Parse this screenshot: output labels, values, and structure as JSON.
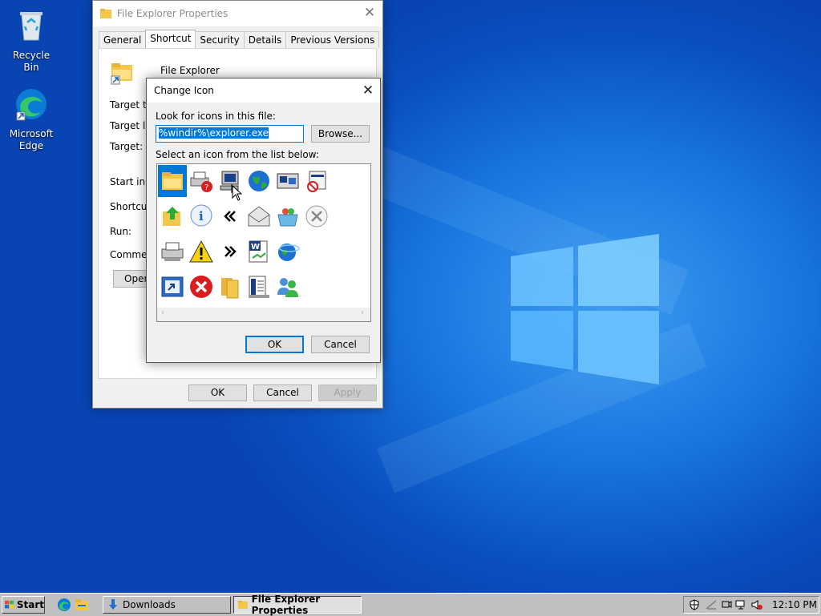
{
  "desktop": {
    "icons": [
      {
        "label_line1": "Recycle Bin",
        "label_line2": ""
      },
      {
        "label_line1": "Microsoft",
        "label_line2": "Edge"
      }
    ]
  },
  "properties": {
    "title": "File Explorer Properties",
    "tabs": [
      "General",
      "Shortcut",
      "Security",
      "Details",
      "Previous Versions"
    ],
    "active_tab": "Shortcut",
    "item_name": "File Explorer",
    "fields": {
      "target_type": "Target typ",
      "target_location": "Target loc",
      "target": "Target:",
      "start_in": "Start in:",
      "shortcut_key": "Shortcut k",
      "run": "Run:",
      "comment": "Comment:"
    },
    "open_button": "Open",
    "ok": "OK",
    "cancel": "Cancel",
    "apply": "Apply"
  },
  "change_icon": {
    "title": "Change Icon",
    "look_label": "Look for icons in this file:",
    "path_value": "%windir%\\explorer.exe",
    "browse": "Browse...",
    "select_label": "Select an icon from the list below:",
    "ok": "OK",
    "cancel": "Cancel",
    "icons": [
      "folder-icon",
      "printer-help-icon",
      "computer-terminal-icon",
      "globe-icon",
      "network-window-icon",
      "blocked-window-icon",
      "folder-up-arrow-icon",
      "info-icon",
      "rewind-arrows-icon",
      "envelope-icon",
      "basket-icon",
      "cancel-circle-icon",
      "printer-icon",
      "warning-icon",
      "forward-arrows-icon",
      "word-document-icon",
      "globe-network-icon",
      "refresh-window-icon",
      "error-icon",
      "folder-pair-icon",
      "server-list-icon",
      "users-icon"
    ],
    "selected_icon_index": 0
  },
  "taskbar": {
    "start": "Start",
    "downloads": "Downloads",
    "active_window": "File Explorer Properties",
    "clock": "12:10 PM"
  },
  "colors": {
    "accent": "#0078d7",
    "desktop_blue": "#1877e0",
    "taskbar_gray": "#c0c0c0"
  }
}
